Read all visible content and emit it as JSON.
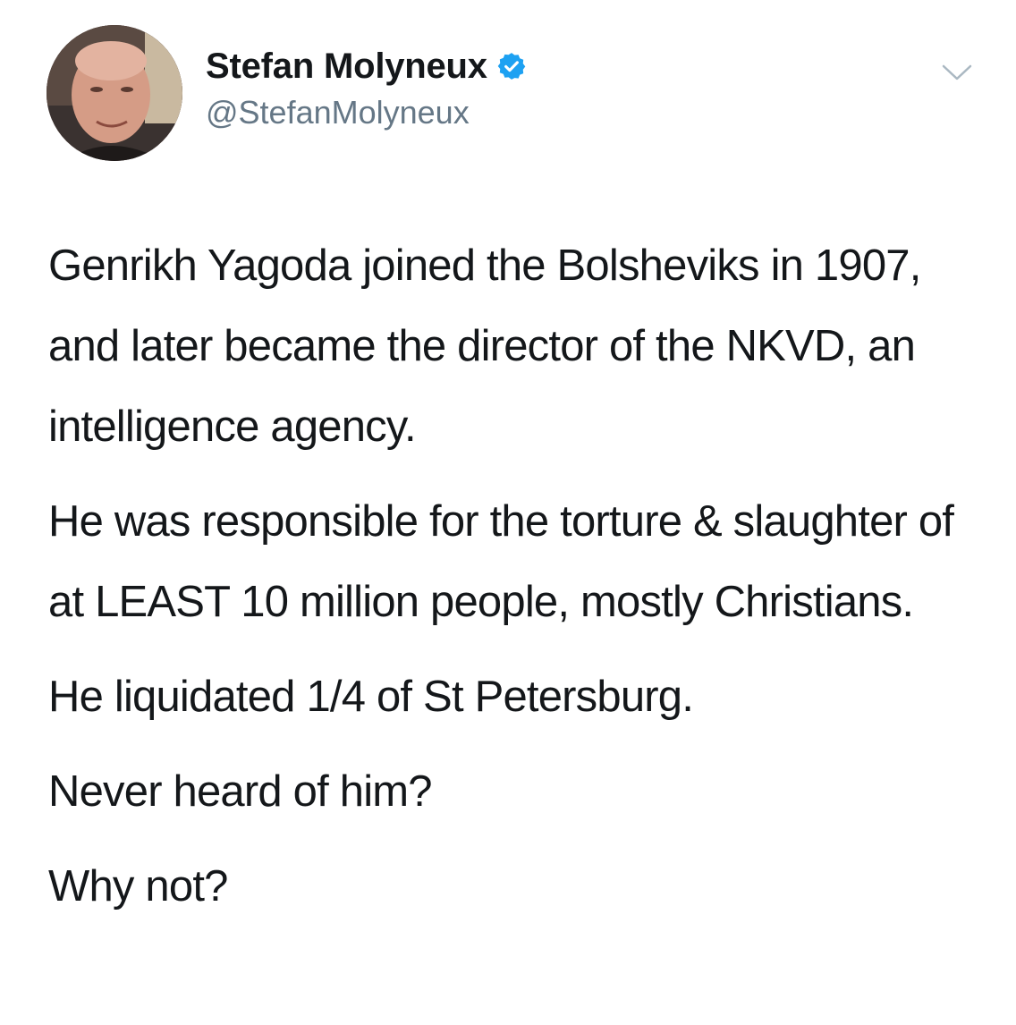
{
  "tweet": {
    "author": {
      "display_name": "Stefan Molyneux",
      "handle": "@StefanMolyneux",
      "verified": true,
      "avatar_icon": "user-avatar-photo"
    },
    "menu_icon": "chevron-down-icon",
    "paragraphs": [
      "Genrikh Yagoda joined the Bolsheviks in 1907, and later became the director of the NKVD, an intelligence agency.",
      "He was responsible for the torture & slaughter of at LEAST 10 million people, mostly Christians.",
      "He liquidated 1/4 of St Petersburg.",
      "Never heard of him?",
      "Why not?"
    ],
    "colors": {
      "text": "#14171a",
      "secondary": "#657786",
      "verified_blue": "#1da1f2"
    }
  }
}
